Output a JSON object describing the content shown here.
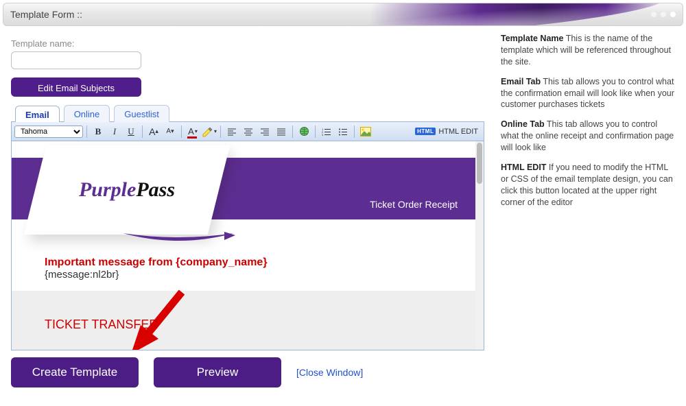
{
  "titlebar": {
    "text": "Template Form ::"
  },
  "form": {
    "template_name_label": "Template name:",
    "template_name_value": "",
    "edit_subjects_btn": "Edit Email Subjects"
  },
  "tabs": [
    {
      "label": "Email",
      "active": true
    },
    {
      "label": "Online",
      "active": false
    },
    {
      "label": "Guestlist",
      "active": false
    }
  ],
  "toolbar": {
    "font": "Tahoma",
    "html_edit_label": "HTML EDIT",
    "html_chip": "HTML"
  },
  "canvas": {
    "receipt_title": "Ticket Order Receipt",
    "logo_purple": "Purple",
    "logo_pass": "Pass",
    "msg_title": "Important message from {company_name}",
    "msg_body": "{message:nl2br}",
    "ticket_transfer": "TICKET TRANSFER"
  },
  "bottom": {
    "create_btn": "Create Template",
    "preview_btn": "Preview",
    "close_link": "[Close Window]"
  },
  "help": {
    "tn_b": "Template Name",
    "tn_t": " This is the name of the template which will be referenced throughout the site.",
    "em_b": "Email Tab",
    "em_t": " This tab allows you to control what the confirmation email will look like when your customer purchases tickets",
    "on_b": "Online Tab",
    "on_t": " This tab allows you to control what the online receipt and confirmation page will look like",
    "he_b": "HTML EDIT",
    "he_t": " If you need to modify the HTML or CSS of the email template design, you can click this button located at the upper right corner of the editor"
  }
}
